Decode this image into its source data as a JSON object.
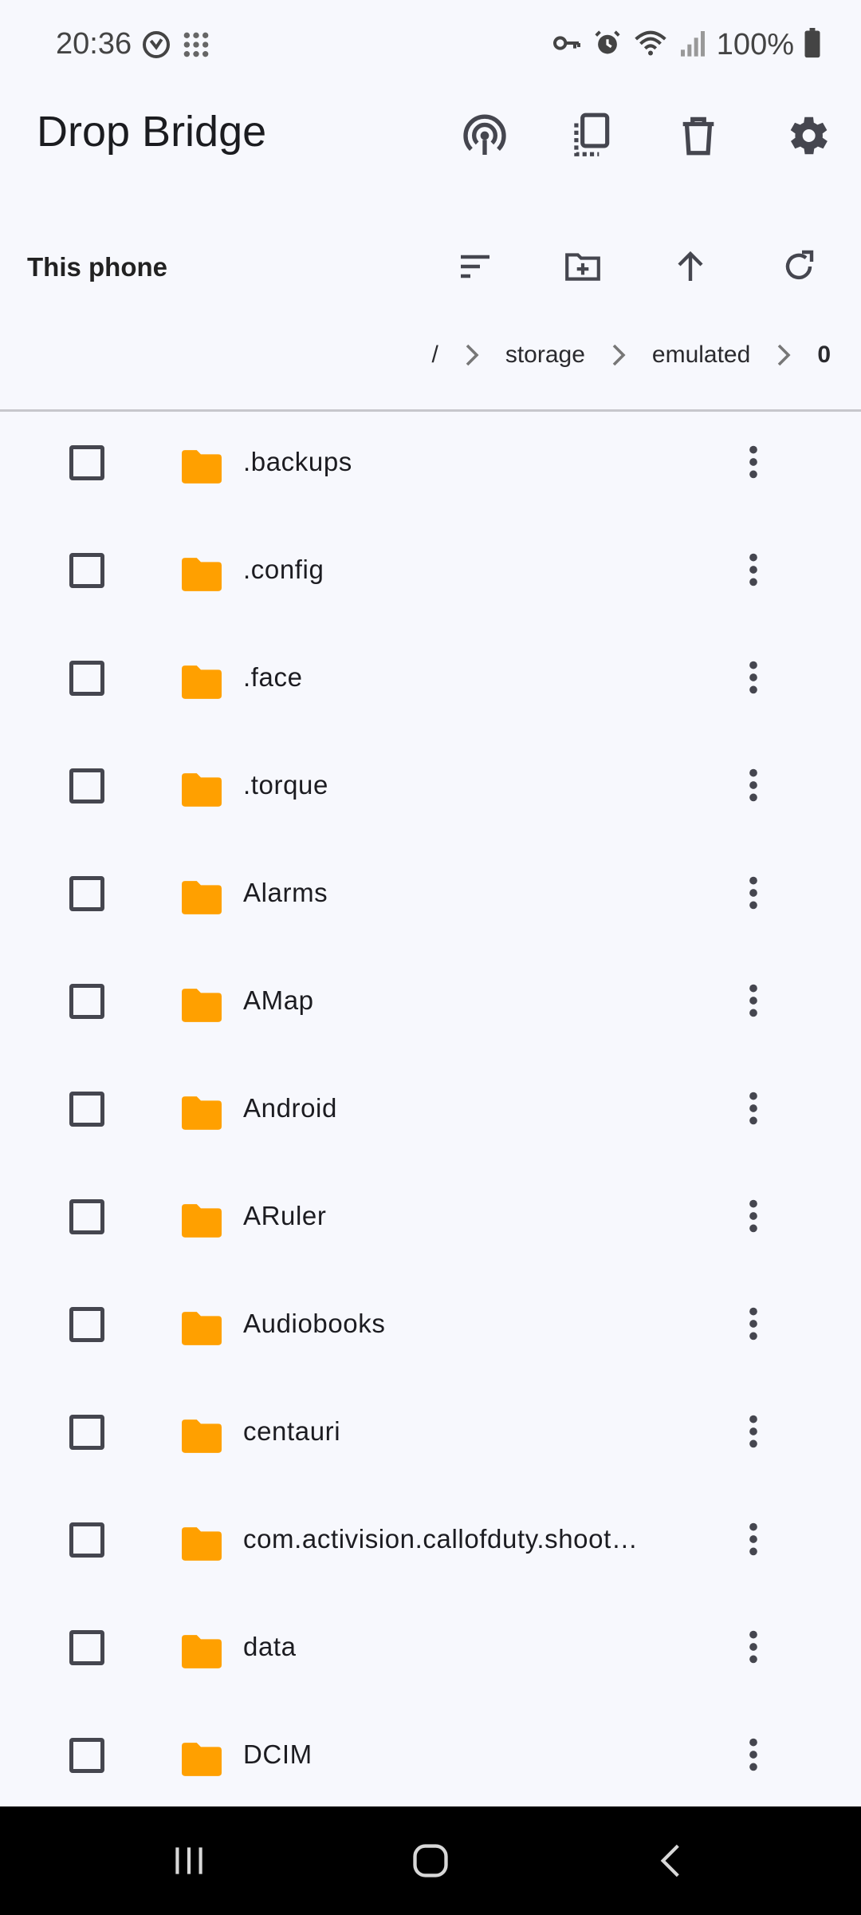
{
  "status_bar": {
    "time": "20:36",
    "battery": "100%",
    "left_icons": [
      "do-not-disturb-icon",
      "app-grid-icon"
    ],
    "right_icons": [
      "vpn-key-icon",
      "alarm-icon",
      "wifi-icon",
      "signal-icon",
      "battery-icon"
    ]
  },
  "app_bar": {
    "title": "Drop Bridge",
    "actions": [
      "broadcast-icon",
      "copy-icon",
      "delete-icon",
      "settings-icon"
    ]
  },
  "location_bar": {
    "title": "This phone",
    "actions": [
      "sort-icon",
      "new-folder-icon",
      "up-arrow-icon",
      "refresh-icon"
    ]
  },
  "breadcrumb": [
    "/",
    "storage",
    "emulated",
    "0"
  ],
  "files": [
    {
      "name": ".backups"
    },
    {
      "name": ".config"
    },
    {
      "name": ".face"
    },
    {
      "name": ".torque"
    },
    {
      "name": "Alarms"
    },
    {
      "name": "AMap"
    },
    {
      "name": "Android"
    },
    {
      "name": "ARuler"
    },
    {
      "name": "Audiobooks"
    },
    {
      "name": "centauri"
    },
    {
      "name": "com.activision.callofduty.shoot…"
    },
    {
      "name": "data"
    },
    {
      "name": "DCIM"
    }
  ],
  "colors": {
    "folder": "#FFA000",
    "background": "#F7F8FD",
    "icon": "#45464F",
    "nav_bar": "#000000"
  }
}
